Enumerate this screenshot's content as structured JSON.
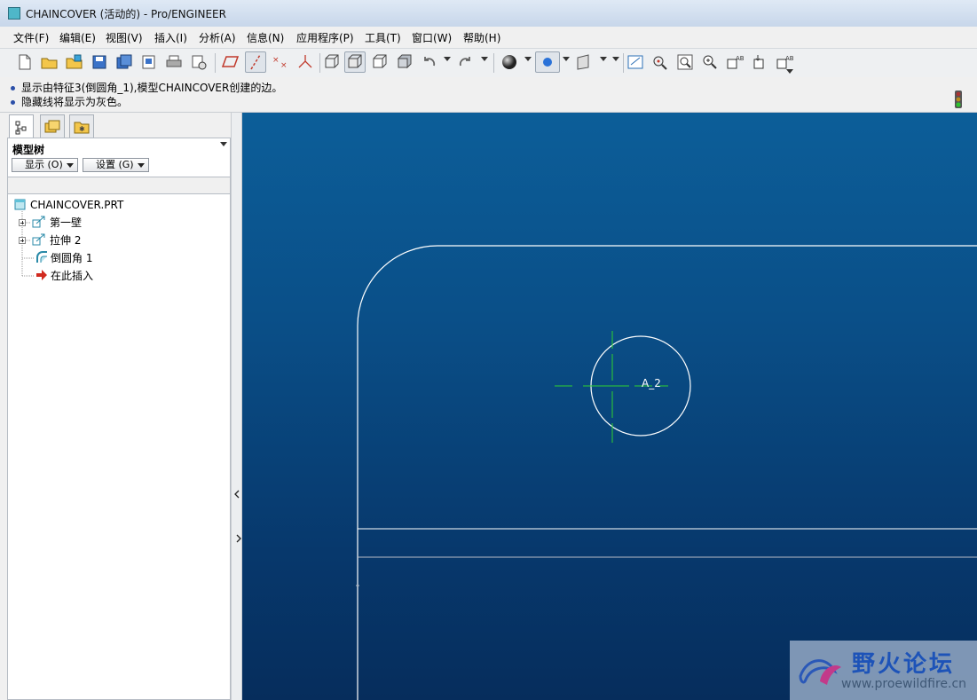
{
  "window": {
    "title": "CHAINCOVER (活动的) - Pro/ENGINEER"
  },
  "menubar": {
    "items": [
      "文件(F)",
      "编辑(E)",
      "视图(V)",
      "插入(I)",
      "分析(A)",
      "信息(N)",
      "应用程序(P)",
      "工具(T)",
      "窗口(W)",
      "帮助(H)"
    ]
  },
  "toolbar": {
    "icons": [
      "new-file-icon",
      "open-file-icon",
      "open-session-icon",
      "save-icon",
      "save-copy-icon",
      "backup-icon",
      "print-icon",
      "send-mail-icon",
      "datum-plane-display-icon",
      "datum-axis-display-icon",
      "datum-point-display-icon",
      "coordinate-system-display-icon",
      "wireframe-icon",
      "hidden-line-icon",
      "no-hidden-icon",
      "shading-icon",
      "undo-icon",
      "redo-icon",
      "appearance-sphere-icon",
      "color-icon",
      "view-manager-icon",
      "sketch-orientation-icon",
      "spin-center-icon",
      "zoom-window-icon",
      "zoom-in-icon",
      "refit-icon",
      "reorient-icon",
      "saved-views-icon"
    ]
  },
  "messages": [
    "显示由特征3(倒圆角_1),模型CHAINCOVER创建的边。",
    "隐藏线将显示为灰色。"
  ],
  "model_tree": {
    "title": "模型树",
    "show_button": "显示 (O)",
    "settings_button": "设置 (G)",
    "root": "CHAINCOVER.PRT",
    "items": [
      {
        "label": "第一壁",
        "icon": "feature-icon",
        "expandable": true
      },
      {
        "label": "拉伸 2",
        "icon": "extrude-icon",
        "expandable": true
      },
      {
        "label": "倒圆角 1",
        "icon": "round-icon",
        "expandable": false
      },
      {
        "label": "在此插入",
        "icon": "insert-here-arrow-icon",
        "expandable": false
      }
    ]
  },
  "graphics": {
    "axis_label": "A_2",
    "colors": {
      "edge": "#ffffff",
      "axis": "#2fd12f"
    }
  },
  "watermark": {
    "name": "野火论坛",
    "url": "www.proewildfire.cn"
  },
  "colors": {
    "graphics_top": "#0c5e99",
    "graphics_bottom": "#062d5c",
    "message_bullet": "#2b4fa8"
  }
}
